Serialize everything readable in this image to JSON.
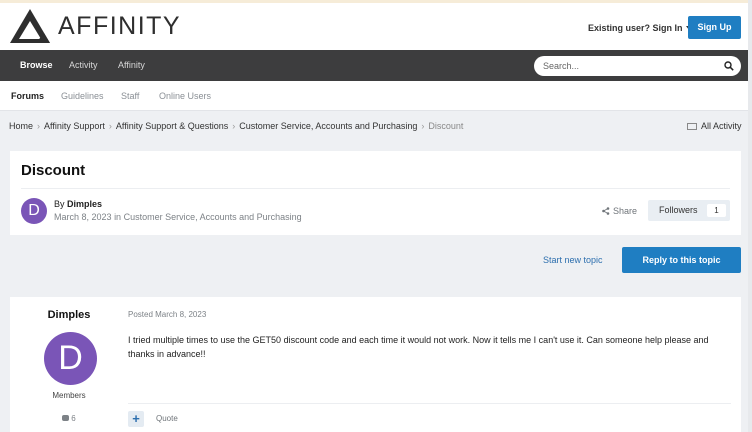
{
  "header": {
    "brand": "AFFINITY",
    "signin_label": "Existing user? Sign In",
    "signup_label": "Sign Up"
  },
  "nav": {
    "tabs": [
      {
        "label": "Browse",
        "active": true
      },
      {
        "label": "Activity",
        "active": false
      },
      {
        "label": "Affinity",
        "active": false
      }
    ],
    "search_placeholder": "Search..."
  },
  "subnav": {
    "items": [
      {
        "label": "Forums",
        "active": true
      },
      {
        "label": "Guidelines",
        "active": false
      },
      {
        "label": "Staff",
        "active": false
      },
      {
        "label": "Online Users",
        "active": false
      }
    ]
  },
  "breadcrumb": {
    "items": [
      "Home",
      "Affinity Support",
      "Affinity Support & Questions",
      "Customer Service, Accounts and Purchasing",
      "Discount"
    ],
    "all_activity": "All Activity"
  },
  "topic": {
    "title": "Discount",
    "avatar_letter": "D",
    "by_prefix": "By",
    "author": "Dimples",
    "date": "March 8, 2023",
    "in_word": "in",
    "forum": "Customer Service, Accounts and Purchasing",
    "share_label": "Share",
    "followers_label": "Followers",
    "followers_count": "1"
  },
  "actions": {
    "start_new_topic": "Start new topic",
    "reply": "Reply to this topic"
  },
  "post": {
    "author": "Dimples",
    "avatar_letter": "D",
    "group": "Members",
    "post_count": "6",
    "posted": "Posted March 8, 2023",
    "body": "I tried multiple times to use the GET50 discount code and each time it would not work. Now it tells me I can't use it. Can someone help please and thanks in advance!!",
    "plus": "+",
    "quote": "Quote"
  },
  "colors": {
    "accent": "#1f7ec2",
    "nav_bg": "#3d3d3e",
    "avatar": "#7a55b7"
  }
}
